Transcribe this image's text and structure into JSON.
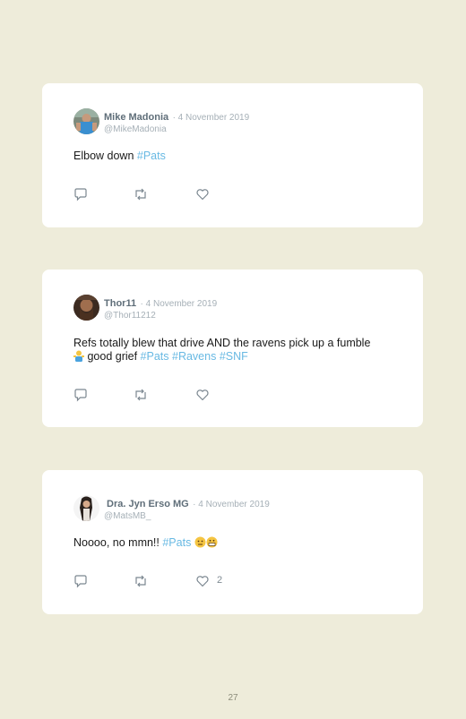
{
  "tweets": [
    {
      "name": "Mike Madonia",
      "date": "· 4 November 2019",
      "handle": "@MikeMadonia",
      "text_plain": "Elbow down ",
      "hashtags": [
        "#Pats"
      ],
      "likes": ""
    },
    {
      "name": "Thor11",
      "date": "· 4 November 2019",
      "handle": "@Thor11212",
      "text_plain": "Refs totally blew that drive AND the ravens pick up a fumble",
      "text_line2": " good grief ",
      "hashtags": [
        "#Pats",
        "#Ravens",
        "#SNF"
      ],
      "likes": ""
    },
    {
      "name": "Dra. Jyn Erso MG",
      "date": "· 4 November 2019",
      "handle": "@MatsMB_",
      "text_plain": "Noooo, no mmn!! ",
      "hashtags": [
        "#Pats"
      ],
      "likes": "2"
    }
  ],
  "icons": [
    "reply-icon",
    "retweet-icon",
    "like-icon"
  ],
  "page_number": "27",
  "colors": {
    "background": "#eeecda",
    "card": "#ffffff",
    "hashtag": "#68b9e3",
    "name": "#5f6e79",
    "meta": "#a6b0b7"
  }
}
